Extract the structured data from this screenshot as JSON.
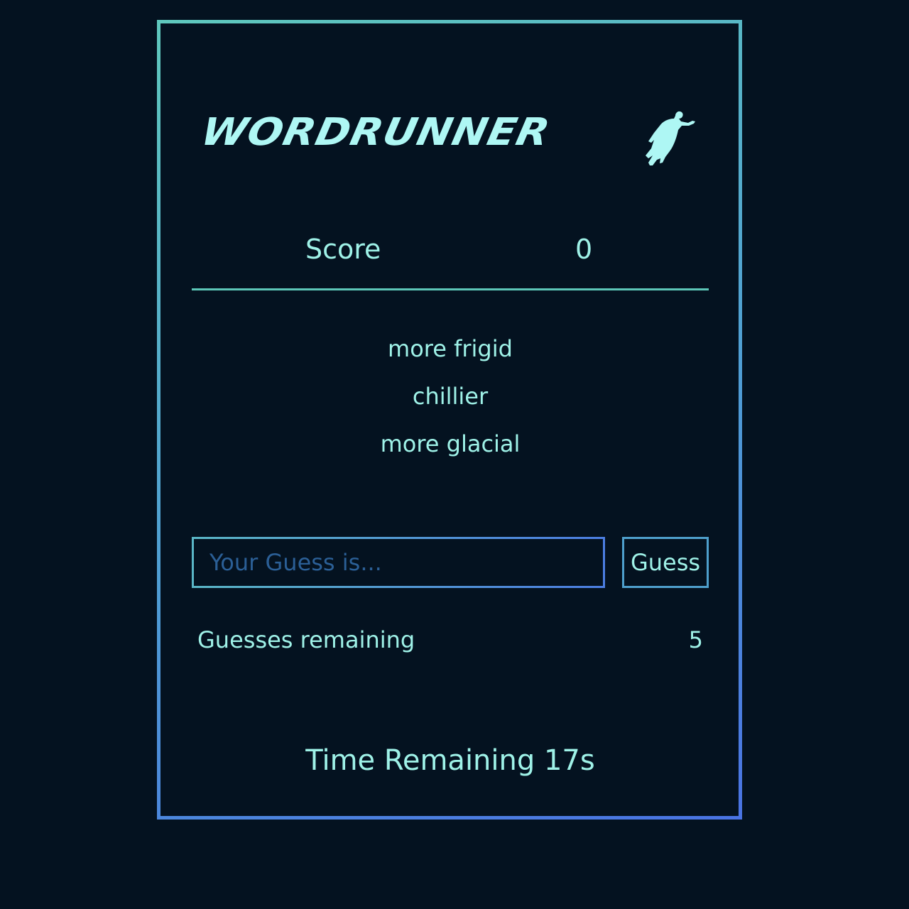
{
  "game": {
    "title": "WORDRUNNER",
    "icon": "runner-icon"
  },
  "score": {
    "label": "Score",
    "value": "0"
  },
  "clues": [
    "more frigid",
    "chillier",
    "more glacial"
  ],
  "guess": {
    "placeholder": "Your Guess is...",
    "value": "",
    "button_label": "Guess"
  },
  "guesses_remaining": {
    "label": "Guesses remaining",
    "value": "5"
  },
  "timer": {
    "label": "Time Remaining",
    "value": "17s"
  },
  "colors": {
    "background": "#041220",
    "text": "#9ff2e8",
    "logo": "#aef7f4",
    "border_start": "#5fc8bd",
    "border_end": "#4a73e3"
  }
}
